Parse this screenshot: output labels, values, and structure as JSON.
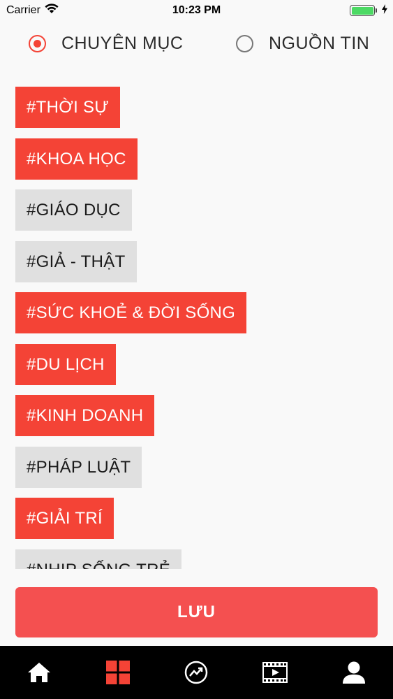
{
  "status_bar": {
    "carrier": "Carrier",
    "time": "10:23 PM",
    "battery_level": 1.0
  },
  "filter": {
    "options": [
      {
        "label": "CHUYÊN MỤC",
        "selected": true
      },
      {
        "label": "NGUỒN TIN",
        "selected": false
      }
    ]
  },
  "tags": [
    {
      "label": "#THỜI SỰ",
      "selected": true
    },
    {
      "label": "#KHOA HỌC",
      "selected": true
    },
    {
      "label": "#GIÁO DỤC",
      "selected": false
    },
    {
      "label": "#GIẢ - THẬT",
      "selected": false
    },
    {
      "label": "#SỨC KHOẺ & ĐỜI SỐNG",
      "selected": true
    },
    {
      "label": "#DU LỊCH",
      "selected": true
    },
    {
      "label": "#KINH DOANH",
      "selected": true
    },
    {
      "label": "#PHÁP LUẬT",
      "selected": false
    },
    {
      "label": "#GIẢI TRÍ",
      "selected": true
    },
    {
      "label": "#NHỊP SỐNG TRẺ",
      "selected": false
    }
  ],
  "save_label": "LƯU",
  "colors": {
    "accent": "#f44336",
    "tag_off": "#e0e0e0",
    "tab_active": "#f44336",
    "tab_inactive": "#ffffff"
  },
  "tab_bar": {
    "tabs": [
      {
        "icon": "home-icon",
        "active": false
      },
      {
        "icon": "grid-icon",
        "active": true
      },
      {
        "icon": "trending-icon",
        "active": false
      },
      {
        "icon": "video-icon",
        "active": false
      },
      {
        "icon": "user-icon",
        "active": false
      }
    ]
  }
}
